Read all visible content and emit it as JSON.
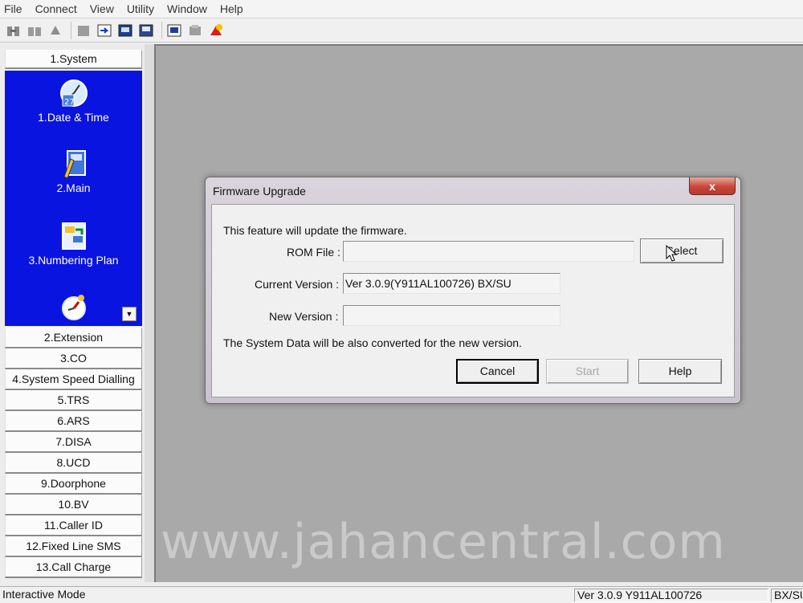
{
  "menu": [
    "File",
    "Connect",
    "View",
    "Utility",
    "Window",
    "Help"
  ],
  "toolbar": {
    "icons": [
      "connect-icon",
      "disconnect-icon",
      "refresh-icon",
      "export-icon",
      "import-icon",
      "print-icon",
      "print-preview-icon",
      "save-icon",
      "upload-icon",
      "help-icon"
    ]
  },
  "nav": {
    "system": "1.System",
    "tiles": [
      {
        "label": "1.Date & Time",
        "icon": "clock-calendar-icon"
      },
      {
        "label": "2.Main",
        "icon": "main-settings-icon"
      },
      {
        "label": "3.Numbering Plan",
        "icon": "numbering-plan-icon"
      },
      {
        "label": "",
        "icon": "timer-icon"
      }
    ],
    "sections": [
      "2.Extension",
      "3.CO",
      "4.System Speed Dialling",
      "5.TRS",
      "6.ARS",
      "7.DISA",
      "8.UCD",
      "9.Doorphone",
      "10.BV",
      "11.Caller ID",
      "12.Fixed Line SMS",
      "13.Call Charge"
    ]
  },
  "dialog": {
    "title": "Firmware Upgrade",
    "close": "x",
    "intro": "This feature will update the firmware.",
    "rom_label": "ROM File :",
    "rom_value": "",
    "current_label": "Current Version :",
    "current_value": "Ver 3.0.9(Y911AL100726) BX/SU",
    "new_label": "New Version :",
    "new_value": "",
    "note": "The System Data will be also converted for the new version.",
    "select": "Select",
    "cancel": "Cancel",
    "start": "Start",
    "help": "Help"
  },
  "watermark": "www.jahancentral.com",
  "status": {
    "mode": "Interactive Mode",
    "version": "Ver 3.0.9 Y911AL100726",
    "region": "BX/SU"
  },
  "colors": {
    "nav_panel": "#0a14e0",
    "workspace": "#a9a9a9",
    "close_button": "#c8473a"
  }
}
